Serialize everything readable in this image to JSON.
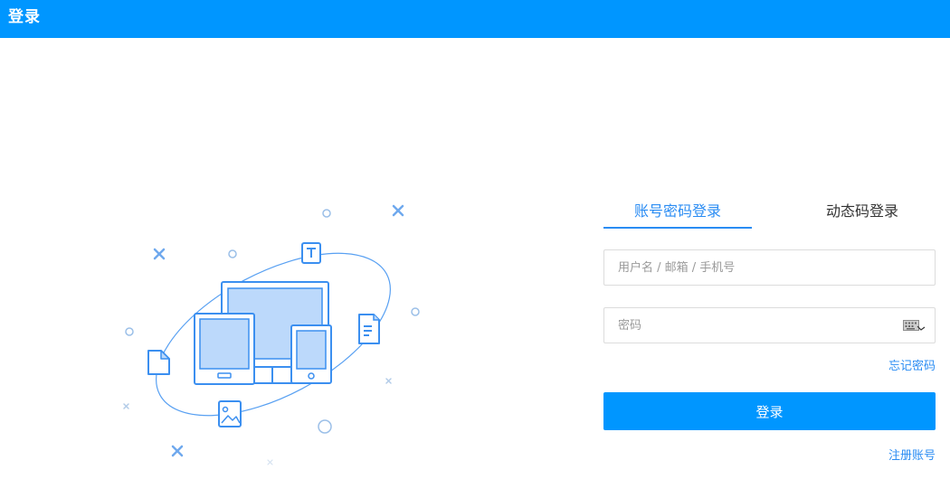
{
  "header": {
    "title": "登录"
  },
  "login": {
    "tabs": [
      {
        "label": "账号密码登录",
        "active": true
      },
      {
        "label": "动态码登录",
        "active": false
      }
    ],
    "username_placeholder": "用户名 / 邮箱 / 手机号",
    "password_placeholder": "密码",
    "forgot_label": "忘记密码",
    "submit_label": "登录",
    "register_label": "注册账号"
  },
  "colors": {
    "brand": "#0096ff",
    "link": "#2a8cf3",
    "illustration_stroke": "#3b8ff0",
    "illustration_fill": "#bcd9fb"
  },
  "icons": {
    "keyboard": "keyboard-icon",
    "text_doc": "text-document-icon",
    "file": "file-icon",
    "image": "image-icon"
  }
}
